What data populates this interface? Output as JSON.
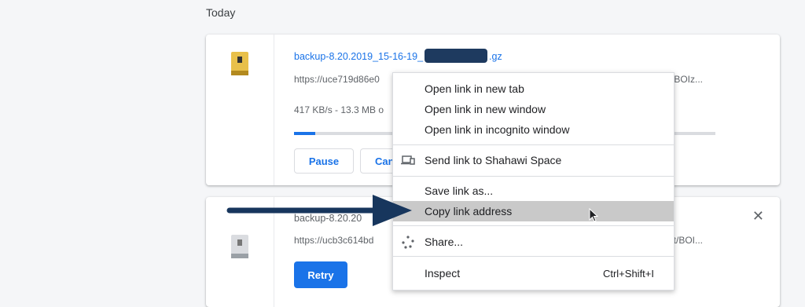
{
  "section_title": "Today",
  "downloads": [
    {
      "filename_prefix": "backup-8.20.2019_15-16-19_",
      "filename_suffix": ".gz",
      "url": "https://uce719d86e0",
      "url_tail": "et/BOIz...",
      "status": "417 KB/s - 13.3 MB o",
      "progress": 0.05,
      "pause_label": "Pause",
      "cancel_label": "Can"
    },
    {
      "filename": "backup-8.20.20",
      "url": "https://ucb3c614bd",
      "url_tail": "et/BOI...",
      "retry_label": "Retry"
    }
  ],
  "context_menu": {
    "open_new_tab": "Open link in new tab",
    "open_new_window": "Open link in new window",
    "open_incognito": "Open link in incognito window",
    "send_link": "Send link to Shahawi Space",
    "save_link_as": "Save link as...",
    "copy_link_address": "Copy link address",
    "share": "Share...",
    "inspect": "Inspect",
    "inspect_shortcut": "Ctrl+Shift+I"
  },
  "colors": {
    "accent": "#1a73e8",
    "arrow": "#17365d",
    "highlight": "#c9c9c9"
  }
}
